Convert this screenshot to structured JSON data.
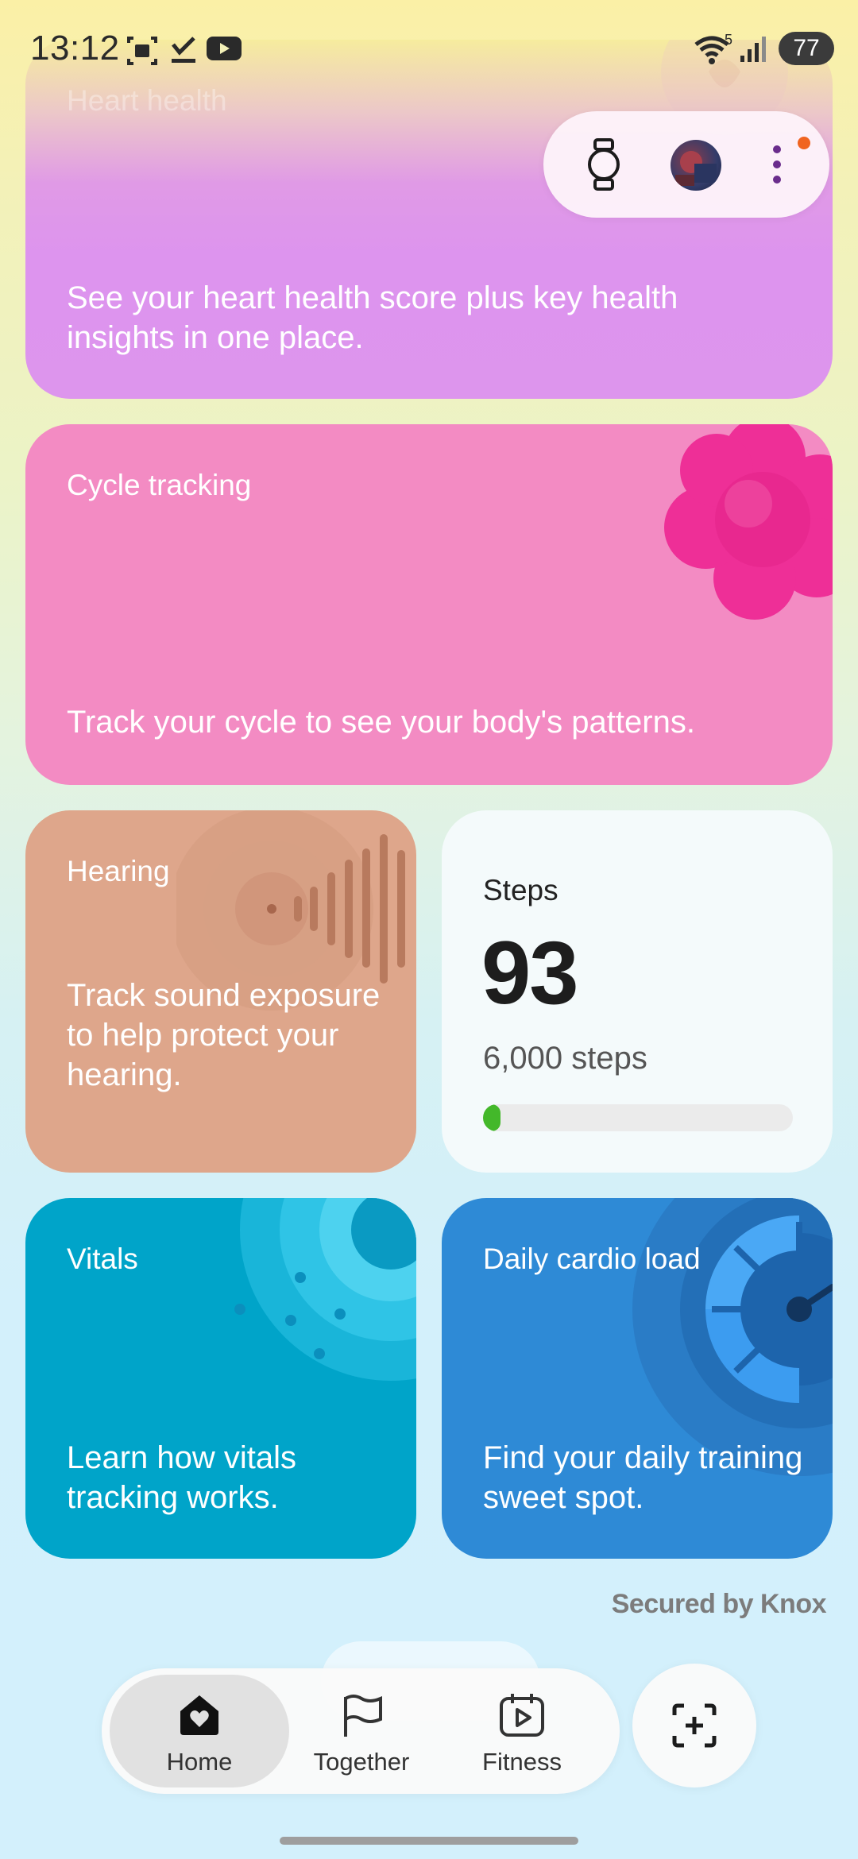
{
  "status_bar": {
    "time": "13:12",
    "wifi_badge": "5",
    "battery": "77",
    "icons": [
      "screenshot-icon",
      "check-icon",
      "youtube-icon",
      "wifi-icon",
      "signal-icon",
      "battery-icon"
    ]
  },
  "header": {
    "icons": [
      "watch-icon",
      "avatar",
      "more-vertical-icon"
    ],
    "notification_dot_color": "#f06420"
  },
  "cards": {
    "heart_health": {
      "title": "Heart health",
      "description": "See your heart health score plus key health insights in one place.",
      "color": "#dd95ed"
    },
    "cycle_tracking": {
      "title": "Cycle tracking",
      "description": "Track your cycle to see your body's patterns.",
      "color": "#f38bc3"
    },
    "hearing": {
      "title": "Hearing",
      "description": "Track sound exposure to help protect your hearing.",
      "color": "#dea68b"
    },
    "steps": {
      "title": "Steps",
      "value": "93",
      "goal": "6,000 steps",
      "progress": 0.0155,
      "bar_color": "#43b82a"
    },
    "vitals": {
      "title": "Vitals",
      "description": "Learn how vitals tracking works.",
      "color": "#00a4c9"
    },
    "cardio": {
      "title": "Daily cardio load",
      "description": "Find your daily training sweet spot.",
      "color": "#2e8ad6"
    }
  },
  "footer": {
    "knox": "Secured by Knox"
  },
  "bottom_nav": {
    "items": [
      {
        "label": "Home",
        "icon": "home-heart-icon",
        "active": true
      },
      {
        "label": "Together",
        "icon": "flag-icon",
        "active": false
      },
      {
        "label": "Fitness",
        "icon": "calendar-play-icon",
        "active": false
      }
    ],
    "fab_icon": "add-capture-icon"
  }
}
